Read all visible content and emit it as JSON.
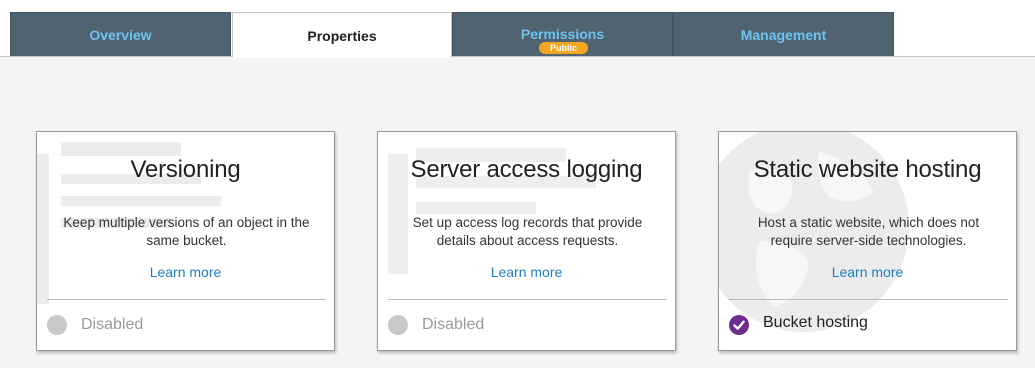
{
  "tabs": [
    {
      "label": "Overview",
      "active": false
    },
    {
      "label": "Properties",
      "active": true
    },
    {
      "label": "Permissions",
      "active": false,
      "badge": "Public"
    },
    {
      "label": "Management",
      "active": false
    }
  ],
  "colors": {
    "tab_bg": "#506371",
    "tab_text": "#6cc3f2",
    "badge": "#f4a623",
    "link": "#1f7fc1",
    "enabled_icon": "#6f2c8c",
    "disabled_icon": "#c8c8c8"
  },
  "cards": [
    {
      "title": "Versioning",
      "description": "Keep multiple versions of an object in the same bucket.",
      "link": "Learn more",
      "status": "Disabled",
      "status_icon": "disabled-circle-icon",
      "enabled": false
    },
    {
      "title": "Server access logging",
      "description": "Set up access log records that provide details about access requests.",
      "link": "Learn more",
      "status": "Disabled",
      "status_icon": "disabled-circle-icon",
      "enabled": false
    },
    {
      "title": "Static website hosting",
      "description": "Host a static website, which does not require server-side technologies.",
      "link": "Learn more",
      "status": "Bucket hosting",
      "status_icon": "check-circle-icon",
      "enabled": true
    }
  ]
}
